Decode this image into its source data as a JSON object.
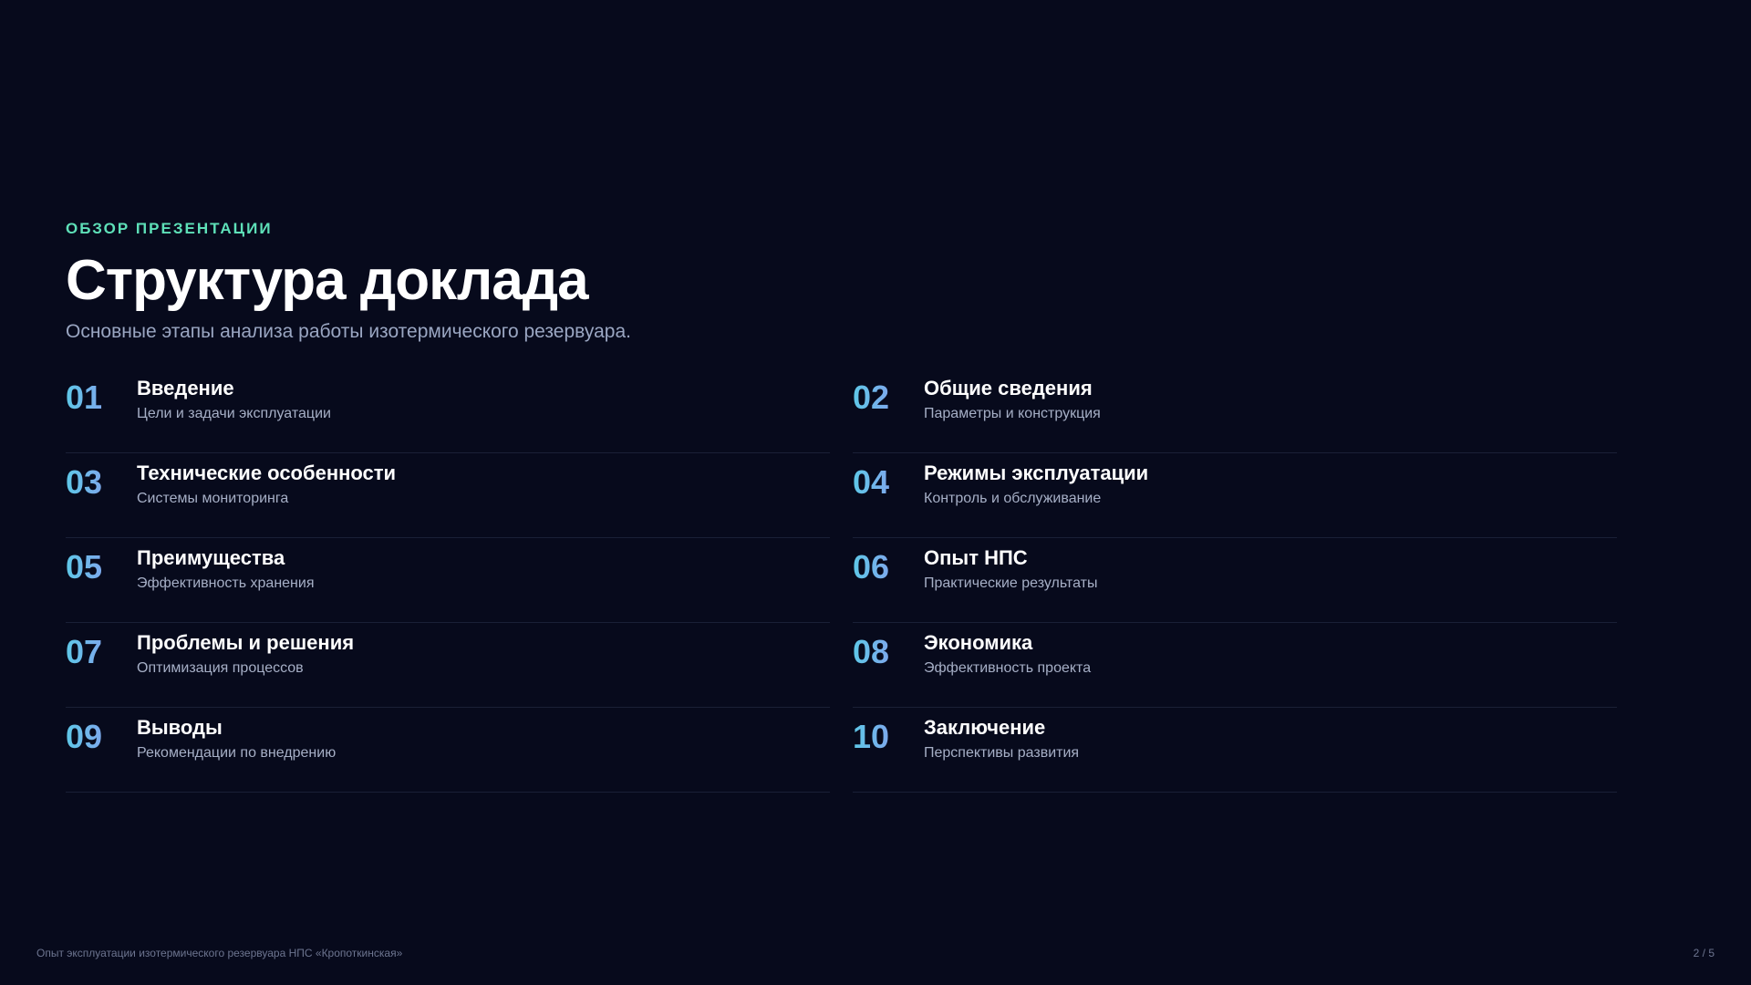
{
  "header": {
    "eyebrow": "ОБЗОР ПРЕЗЕНТАЦИИ",
    "title": "Структура доклада",
    "subtitle": "Основные этапы анализа работы изотермического резервуара."
  },
  "items": [
    {
      "num": "01",
      "title": "Введение",
      "desc": "Цели и задачи эксплуатации"
    },
    {
      "num": "02",
      "title": "Общие сведения",
      "desc": "Параметры и конструкция"
    },
    {
      "num": "03",
      "title": "Технические особенности",
      "desc": "Системы мониторинга"
    },
    {
      "num": "04",
      "title": "Режимы эксплуатации",
      "desc": "Контроль и обслуживание"
    },
    {
      "num": "05",
      "title": "Преимущества",
      "desc": "Эффективность хранения"
    },
    {
      "num": "06",
      "title": "Опыт НПС",
      "desc": "Практические результаты"
    },
    {
      "num": "07",
      "title": "Проблемы и решения",
      "desc": "Оптимизация процессов"
    },
    {
      "num": "08",
      "title": "Экономика",
      "desc": "Эффективность проекта"
    },
    {
      "num": "09",
      "title": "Выводы",
      "desc": "Рекомендации по внедрению"
    },
    {
      "num": "10",
      "title": "Заключение",
      "desc": "Перспективы развития"
    }
  ],
  "footer": {
    "caption": "Опыт эксплуатации изотермического резервуара НПС «Кропоткинская»",
    "page": "2 / 5"
  },
  "colors": {
    "background": "#070a1c",
    "accent": "#5ee0b8",
    "number_gradient_start": "#5ec8e8",
    "number_gradient_end": "#9a8cf0"
  }
}
